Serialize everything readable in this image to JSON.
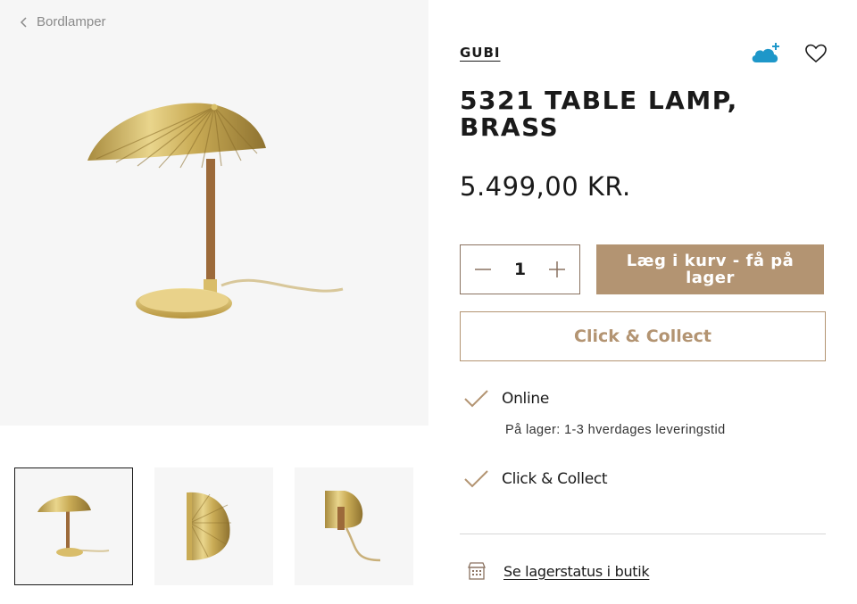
{
  "breadcrumb": {
    "label": "Bordlamper",
    "icon": "chevron-left-icon"
  },
  "gallery": {
    "background": "#f6f6f6",
    "thumbnails": [
      {
        "view": "front",
        "selected": true
      },
      {
        "view": "top",
        "selected": false
      },
      {
        "view": "side",
        "selected": false
      }
    ]
  },
  "product": {
    "brand": "GUBI",
    "title": "5321 TABLE LAMP, BRASS",
    "price": "5.499,00 KR."
  },
  "header_icons": {
    "cloud": "cloud-plus-icon",
    "favorite": "heart-icon"
  },
  "purchase": {
    "quantity": "1",
    "minus_icon": "minus-icon",
    "plus_icon": "plus-icon",
    "add_to_cart_label": "Læg i kurv - få på lager",
    "click_collect_label": "Click & Collect"
  },
  "availability": {
    "online_label": "Online",
    "online_note": "På lager: 1-3 hverdages leveringstid",
    "click_collect_label": "Click & Collect",
    "check_icon": "checkmark-icon"
  },
  "store_link": {
    "label": "Se lagerstatus i butik",
    "icon": "store-icon"
  },
  "colors": {
    "accent": "#b39472",
    "cloud": "#1e97c9",
    "text": "#1a1a1a",
    "muted": "#8a8a8a"
  }
}
